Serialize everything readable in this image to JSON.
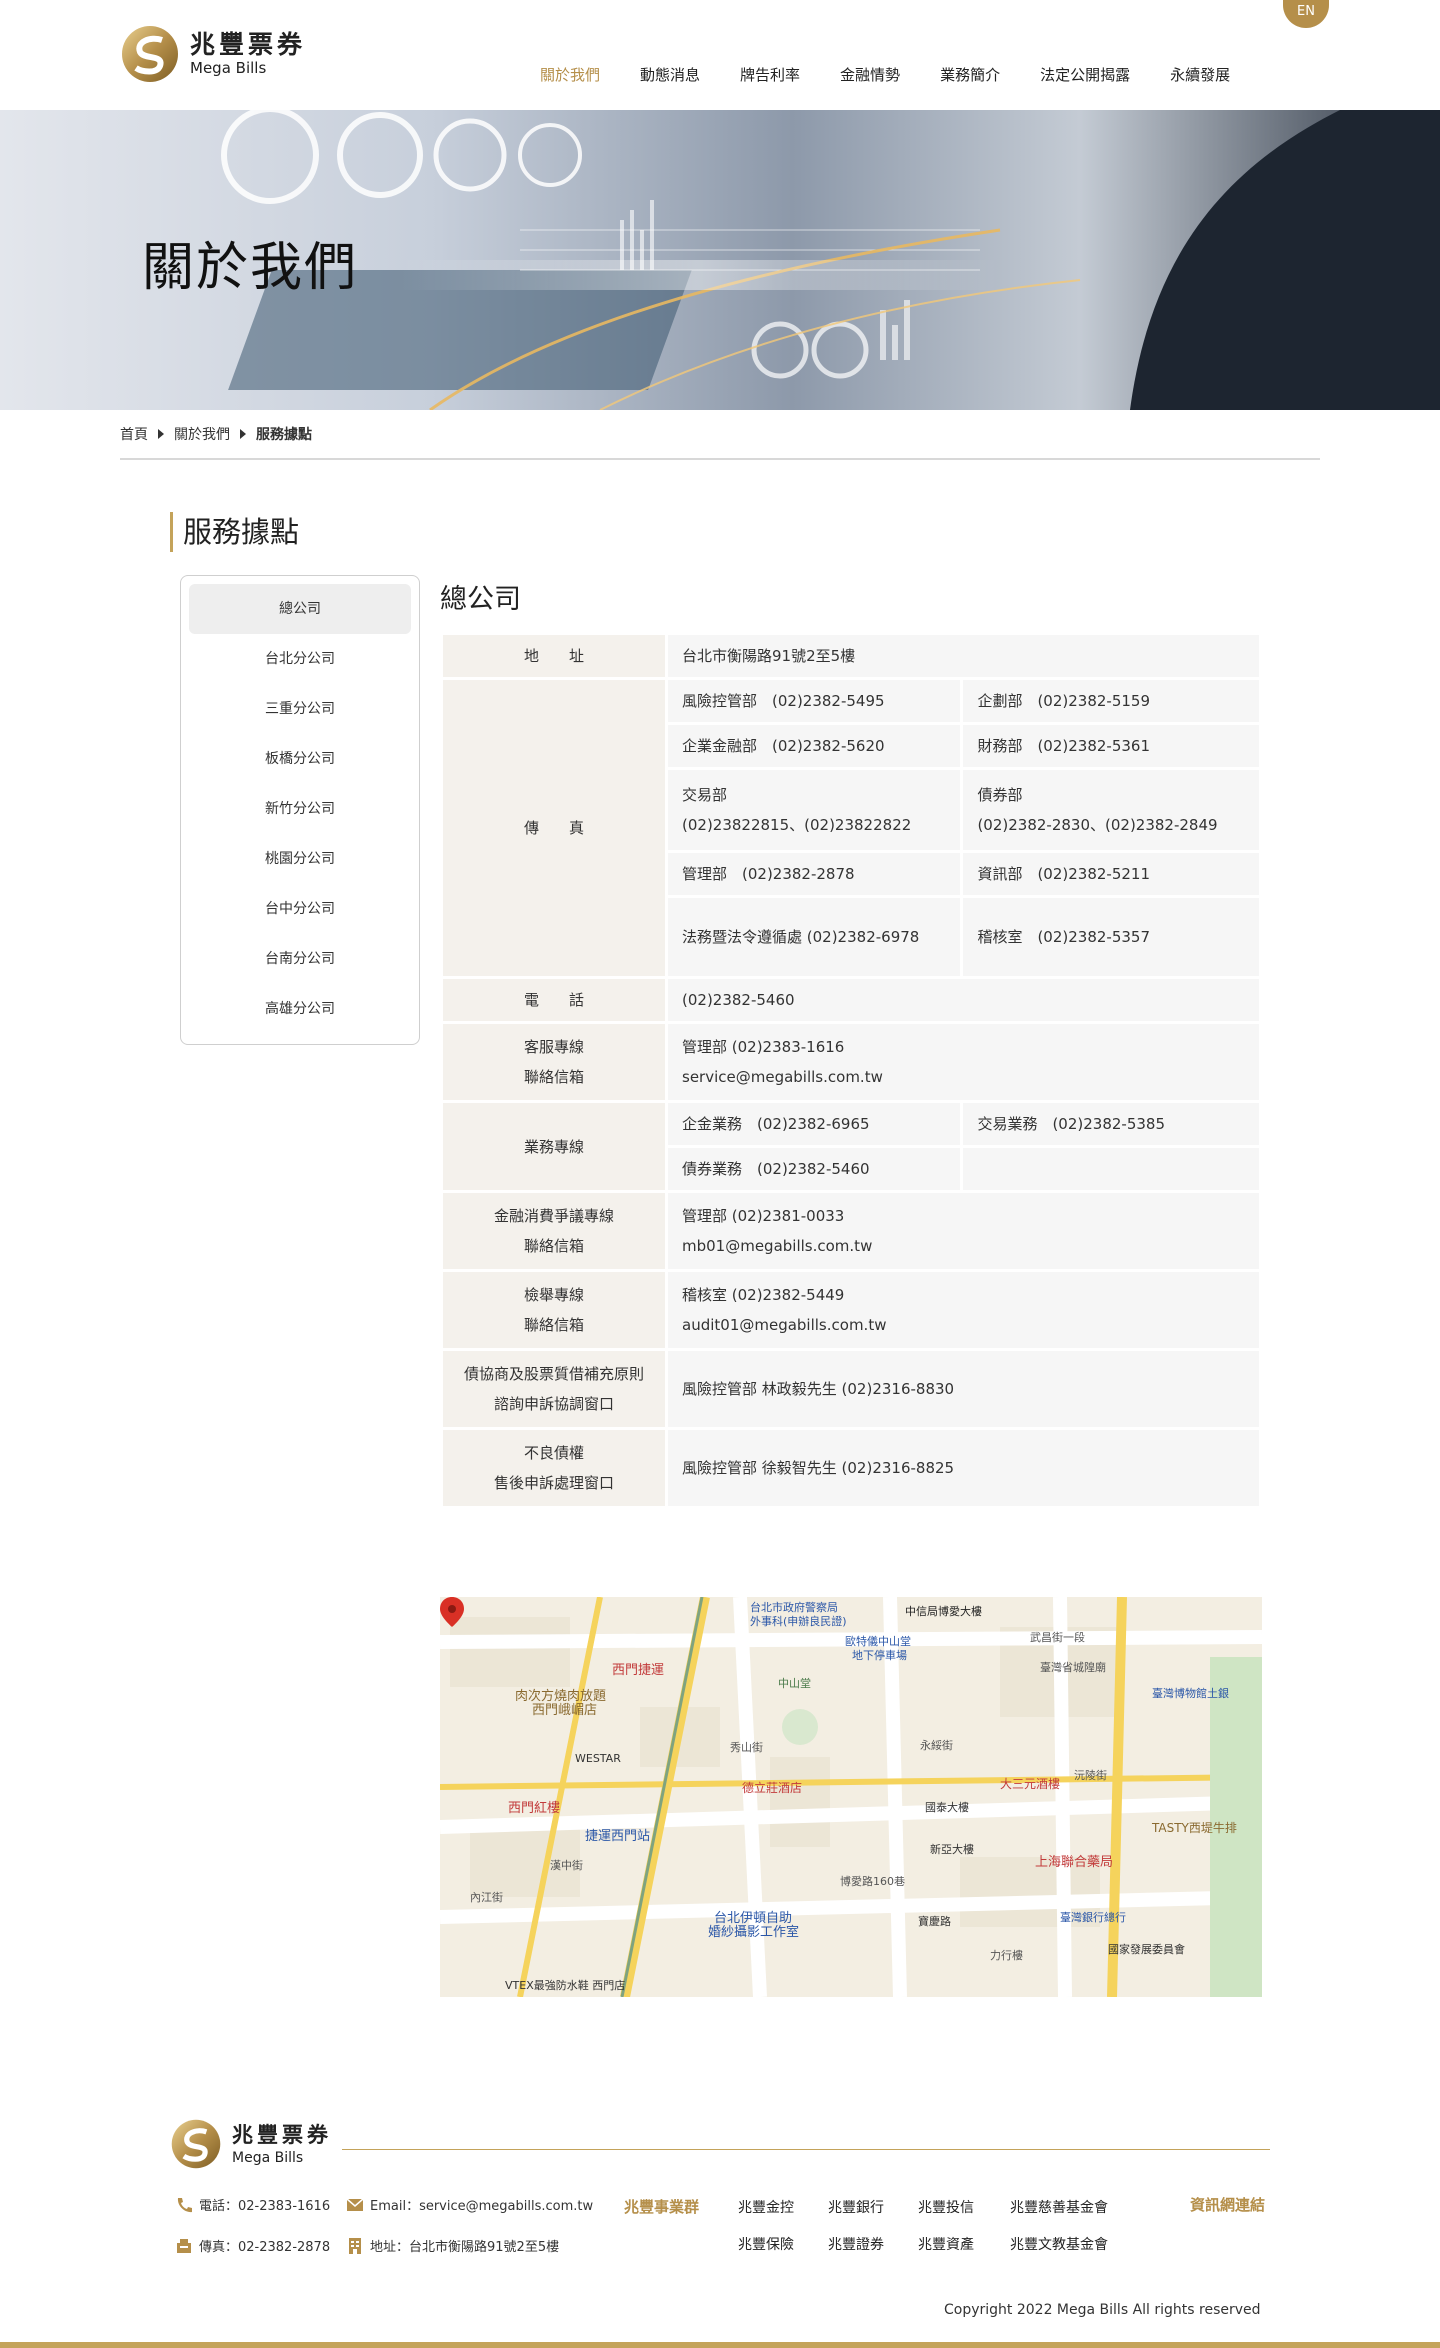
{
  "header": {
    "logo_zh": "兆豐票券",
    "logo_en": "Mega Bills",
    "lang_button": "EN",
    "nav": [
      "關於我們",
      "動態消息",
      "牌告利率",
      "金融情勢",
      "業務簡介",
      "法定公開揭露",
      "永續發展"
    ]
  },
  "banner": {
    "title": "關於我們"
  },
  "breadcrumb": {
    "home": "首頁",
    "parent": "關於我們",
    "current": "服務據點"
  },
  "section_title": "服務據點",
  "sidebar": {
    "items": [
      "總公司",
      "台北分公司",
      "三重分公司",
      "板橋分公司",
      "新竹分公司",
      "桃園分公司",
      "台中分公司",
      "台南分公司",
      "高雄分公司"
    ]
  },
  "content": {
    "title": "總公司",
    "address_label": "地　　址",
    "address": "台北市衡陽路91號2至5樓",
    "fax_label": "傳　　真",
    "fax": [
      [
        "風險控管部　(02)2382-5495",
        "企劃部　(02)2382-5159"
      ],
      [
        "企業金融部　(02)2382-5620",
        "財務部　(02)2382-5361"
      ],
      [
        "交易部",
        "債券部"
      ],
      [
        "管理部　(02)2382-2878",
        "資訊部　(02)2382-5211"
      ],
      [
        "法務暨法令遵循處 (02)2382-6978",
        "稽核室　(02)2382-5357"
      ]
    ],
    "fax_trading_numbers": "(02)23822815、(02)23822822",
    "fax_bond_numbers": "(02)2382-2830、(02)2382-2849",
    "phone_label": "電　　話",
    "phone": "(02)2382-5460",
    "service_label_1": "客服專線",
    "service_label_2": "聯絡信箱",
    "service_line": "管理部  (02)2383-1616",
    "service_email": "service@megabills.com.tw",
    "business_label": "業務專線",
    "business": [
      [
        "企金業務　(02)2382-6965",
        "交易業務　(02)2382-5385"
      ],
      [
        "債券業務　(02)2382-5460",
        ""
      ]
    ],
    "dispute_label_1": "金融消費爭議專線",
    "dispute_label_2": "聯絡信箱",
    "dispute_line": "管理部  (02)2381-0033",
    "dispute_email": "mb01@megabills.com.tw",
    "report_label_1": "檢舉專線",
    "report_label_2": "聯絡信箱",
    "report_line": "稽核室  (02)2382-5449",
    "report_email": "audit01@megabills.com.tw",
    "bond_label_1": "債協商及股票質借補充原則",
    "bond_label_2": "諮詢申訴協調窗口",
    "bond_value": "風險控管部 林政毅先生 (02)2316-8830",
    "npl_label_1": "不良債權",
    "npl_label_2": "售後申訴處理窗口",
    "npl_value": "風險控管部 徐毅智先生 (02)2316-8825"
  },
  "map": {
    "labels": {
      "a": "台北市政府警察局",
      "b": "外事科(申辦良民證)",
      "c": "中信局博愛大樓",
      "d": "武昌街一段",
      "e": "歐特儀中山堂",
      "f": "地下停車場",
      "g": "中山堂",
      "h": "西門捷運",
      "i": "肉次方燒肉放題",
      "j": "西門峨嵋店",
      "k": "臺灣省城隍廟",
      "l": "臺灣博物館土銀",
      "m": "WESTAR",
      "n": "德立莊酒店",
      "o": "國泰大樓",
      "p": "大三元酒樓",
      "q": "西門紅樓",
      "r": "捷運西門站",
      "s": "新亞大樓",
      "t": "上海聯合藥局",
      "u": "TASTY西堤牛排",
      "v": "台北伊頓自助",
      "w": "婚紗攝影工作室",
      "x": "寶慶路",
      "y": "臺灣銀行總行",
      "z": "國家發展委員會",
      "aa": "VTEX最強防水鞋 西門店",
      "ab": "博愛路160巷",
      "ac": "力行樓",
      "ad": "永綏街",
      "ae": "沅陵街",
      "af": "秀山街",
      "ag": "漢中街",
      "ah": "內江街"
    }
  },
  "footer": {
    "logo_zh": "兆豐票券",
    "logo_en": "Mega Bills",
    "phone": "電話：02-2383-1616",
    "email": "Email：service@megabills.com.tw",
    "fax": "傳真：02-2382-2878",
    "address": "地址：台北市衡陽路91號2至5樓",
    "group_title": "兆豐事業群",
    "links": [
      "兆豐金控",
      "兆豐銀行",
      "兆豐投信",
      "兆豐慈善基金會",
      "兆豐保險",
      "兆豐證券",
      "兆豐資產",
      "兆豐文教基金會"
    ],
    "info_title": "資訊網連結",
    "copyright": "Copyright 2022 Mega Bills All rights reserved"
  },
  "colors": {
    "accent": "#c4a35a",
    "accent_dark": "#b58f4a",
    "label_bg": "#f4f1ec",
    "value_bg": "#f6f6f6"
  }
}
